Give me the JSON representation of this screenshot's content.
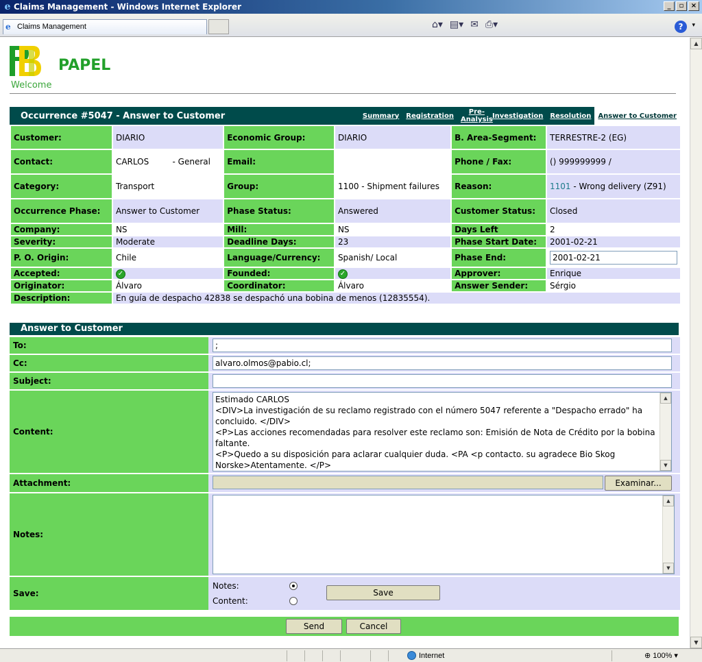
{
  "window": {
    "title": "Claims Management - Windows Internet Explorer",
    "tab_label": "Claims Management"
  },
  "status": {
    "zone": "Internet",
    "zoom": "100%"
  },
  "page": {
    "brand": "PAPEL",
    "welcome": "Welcome",
    "occurrence_title": "Occurrence #5047 - Answer to Customer",
    "tabs": [
      {
        "label": "Summary"
      },
      {
        "label": "Registration"
      },
      {
        "label": "Pre-Analysis"
      },
      {
        "label": "Investigation"
      },
      {
        "label": "Resolution"
      },
      {
        "label": "Answer to Customer"
      }
    ]
  },
  "info": {
    "customer_label": "Customer:",
    "customer": "DIARIO",
    "econ_label": "Economic Group:",
    "econ": "DIARIO",
    "barea_label": "B. Area-Segment:",
    "barea": "TERRESTRE-2 (EG)",
    "contact_label": "Contact:",
    "contact": "CARLOS         - General",
    "email_label": "Email:",
    "email": "",
    "phone_label": "Phone / Fax:",
    "phone": "() 999999999 /",
    "category_label": "Category:",
    "category": "Transport",
    "group_label": "Group:",
    "group": "1100 - Shipment failures",
    "reason_label": "Reason:",
    "reason_code": "1101",
    "reason_text": " - Wrong delivery (Z91)",
    "phase_label": "Occurrence Phase:",
    "phase": "Answer to Customer",
    "phase_status_label": "Phase Status:",
    "phase_status": "Answered",
    "cust_status_label": "Customer Status:",
    "cust_status": "Closed",
    "company_label": "Company:",
    "company": "NS",
    "mill_label": "Mill:",
    "mill": "NS",
    "days_left_label": "Days Left",
    "days_left": "2",
    "severity_label": "Severity:",
    "severity": "Moderate",
    "deadline_label": "Deadline Days:",
    "deadline": "23",
    "phase_start_label": "Phase Start Date:",
    "phase_start": "2001-02-21",
    "po_label": "P. O. Origin:",
    "po": "Chile",
    "lang_label": "Language/Currency:",
    "lang": "Spanish/ Local",
    "phase_end_label": "Phase End:",
    "phase_end": "2001-02-21",
    "accepted_label": "Accepted:",
    "founded_label": "Founded:",
    "approver_label": "Approver:",
    "approver": "Enrique",
    "originator_label": "Originator:",
    "originator": "Álvaro",
    "coordinator_label": "Coordinator:",
    "coordinator": "Álvaro",
    "sender_label": "Answer Sender:",
    "sender": "Sérgio",
    "description_label": "Description:",
    "description": "En guía de despacho 42838 se despachó una bobina de menos (12835554)."
  },
  "answer": {
    "header": "Answer to Customer",
    "to_label": "To:",
    "to": ";",
    "cc_label": "Cc:",
    "cc": "alvaro.olmos@pabio.cl;",
    "subject_label": "Subject:",
    "subject": "",
    "content_label": "Content:",
    "content": "Estimado CARLOS\n<DIV>La investigación de su reclamo registrado con el número 5047 referente a \"Despacho errado\" ha concluido. </DIV>\n<P>Las acciones recomendadas para resolver este reclamo son: Emisión de Nota de Crédito por la bobina faltante.\n<P>Quedo a su disposición para aclarar cualquier duda. <PA <p contacto. su agradece Bio Skog Norske>Atentamente. </P>",
    "attachment_label": "Attachment:",
    "browse": "Examinar...",
    "notes_label": "Notes:",
    "save_label": "Save:",
    "radio_notes": "Notes:",
    "radio_content": "Content:",
    "save_button": "Save",
    "send_button": "Send",
    "cancel_button": "Cancel"
  },
  "colors": {
    "header_teal": "#004b4b",
    "label_green": "#6ad55a",
    "value_lavender": "#dcdcf8",
    "brand_green": "#22a02a"
  },
  "icons": [
    "ie-icon",
    "home-icon",
    "feeds-icon",
    "mail-icon",
    "print-icon",
    "help-icon",
    "check-icon",
    "globe-icon",
    "zoom-icon"
  ]
}
